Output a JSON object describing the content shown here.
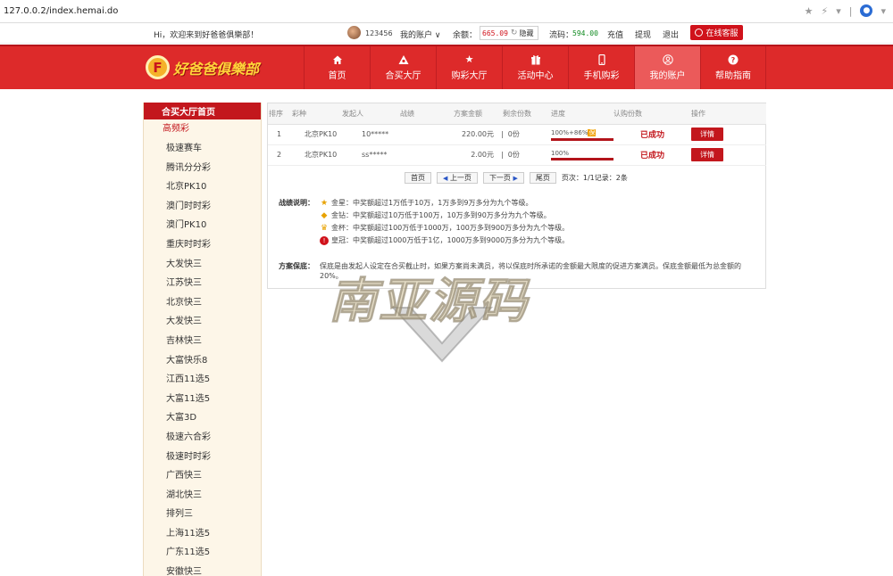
{
  "browser": {
    "url": "127.0.0.2/index.hemai.do"
  },
  "topbar": {
    "welcome": "Hi，欢迎来到好爸爸俱樂部！",
    "user_id": "123456",
    "my_account": "我的账户 ∨",
    "balance_label": "余额：",
    "balance_value": "665.09",
    "hide_label": "隐藏",
    "flow_label": "流码：",
    "flow_value": "594.00",
    "links": [
      "充值",
      "提现",
      "退出"
    ],
    "service_label": "在线客服"
  },
  "logo": {
    "mark": "F",
    "text": "好爸爸俱樂部"
  },
  "nav": [
    {
      "label": "首页",
      "icon": "home-icon"
    },
    {
      "label": "合买大厅",
      "icon": "triangle-icon"
    },
    {
      "label": "购彩大厅",
      "icon": "star-icon"
    },
    {
      "label": "活动中心",
      "icon": "gift-icon"
    },
    {
      "label": "手机购彩",
      "icon": "phone-icon"
    },
    {
      "label": "我的账户",
      "icon": "user-icon",
      "active": true
    },
    {
      "label": "帮助指南",
      "icon": "question-icon"
    }
  ],
  "sidebar": {
    "header": "合买大厅首页",
    "group": "高频彩",
    "items": [
      "极速赛车",
      "腾讯分分彩",
      "北京PK10",
      "澳门时时彩",
      "澳门PK10",
      "重庆时时彩",
      "大发快三",
      "江苏快三",
      "北京快三",
      "大发快三",
      "吉林快三",
      "大富快乐8",
      "江西11选5",
      "大富11选5",
      "大富3D",
      "极速六合彩",
      "极速时时彩",
      "广西快三",
      "湖北快三",
      "排列三",
      "上海11选5",
      "广东11选5",
      "安徽快三"
    ]
  },
  "table": {
    "headers": [
      "排序",
      "彩种",
      "发起人",
      "战绩",
      "方案金额",
      "剩余份数",
      "进度",
      "认购份数",
      "操作"
    ],
    "rows": [
      {
        "rank": "1",
        "game": "北京PK10",
        "initiator": "10*****",
        "amount": "220.00元",
        "remaining": "0份",
        "progress_text": "100%+86%",
        "progress_badge": "保",
        "progress": 1.0,
        "status": "已成功",
        "action": "详情"
      },
      {
        "rank": "2",
        "game": "北京PK10",
        "initiator": "ss*****",
        "amount": "2.00元",
        "remaining": "0份",
        "progress_text": "100%",
        "progress_badge": "",
        "progress": 1.0,
        "status": "已成功",
        "action": "详情"
      }
    ]
  },
  "pager": {
    "first": "首页",
    "prev": "上一页",
    "next": "下一页",
    "last": "尾页",
    "info": "页次：1/1记录：2条"
  },
  "explain": {
    "title": "战绩说明：",
    "rows": [
      {
        "icon": "star-badge-icon",
        "text": "金星：中奖额超过1万低于10万，1万多到9万多分为九个等级。"
      },
      {
        "icon": "diamond-icon",
        "text": "金钻：中奖额超过10万低于100万，10万多到90万多分为九个等级。"
      },
      {
        "icon": "trophy-icon",
        "text": "金杯：中奖额超过100万低于1000万，100万多到900万多分为九个等级。"
      },
      {
        "icon": "crown-icon",
        "text": "皇冠：中奖额超过1000万低于1亿，1000万多到9000万多分为九个等级。"
      }
    ]
  },
  "guarantee": {
    "title": "方案保底：",
    "text": "保底是由发起人设定在合买截止时，如果方案尚未满员，将以保底时所承诺的金额最大限度的促进方案满员。保底金额最低为总金额的20%。"
  },
  "watermark": {
    "text": "南亚源码"
  },
  "colors": {
    "brand_red": "#dd2a2a",
    "dark_red": "#c3171d",
    "success_green": "#108a20"
  }
}
